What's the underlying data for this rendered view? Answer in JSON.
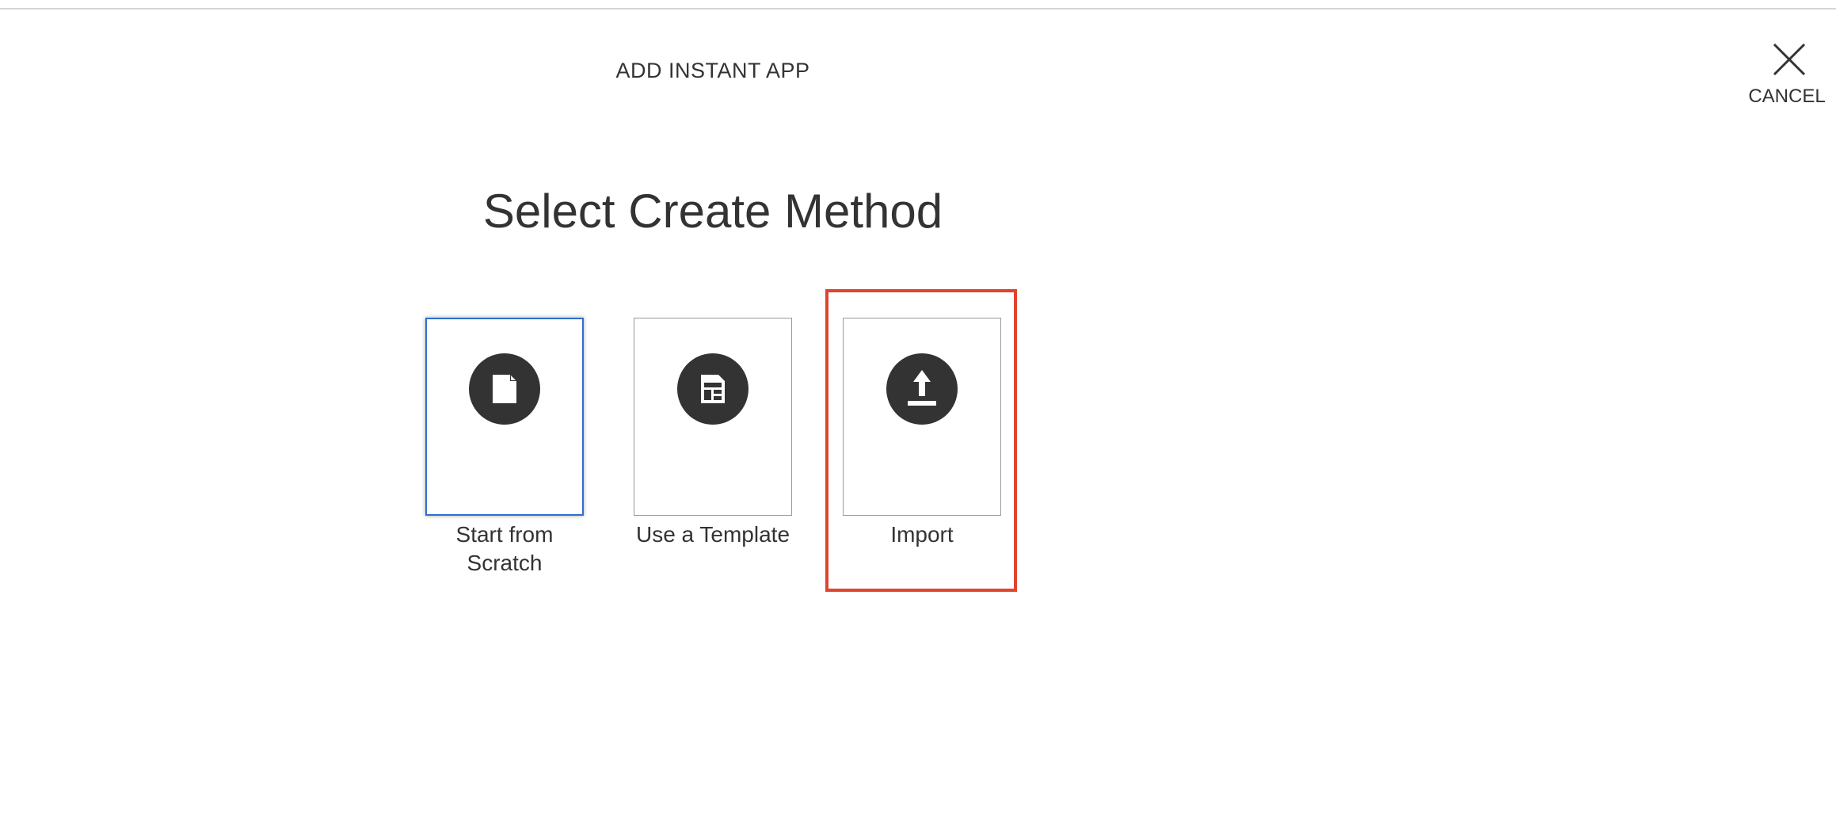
{
  "header": {
    "title": "ADD INSTANT APP",
    "cancel_label": "CANCEL",
    "cancel_icon": "close-icon"
  },
  "main": {
    "heading": "Select Create Method",
    "options": [
      {
        "label": "Start from Scratch",
        "icon": "document-icon",
        "selected": true
      },
      {
        "label": "Use a Template",
        "icon": "template-icon",
        "selected": false
      },
      {
        "label": "Import",
        "icon": "upload-icon",
        "selected": false,
        "highlighted": true
      }
    ]
  },
  "colors": {
    "selected_border": "#2e6fd0",
    "highlight": "#e0442c",
    "icon_background": "#333333",
    "text": "#333333"
  }
}
